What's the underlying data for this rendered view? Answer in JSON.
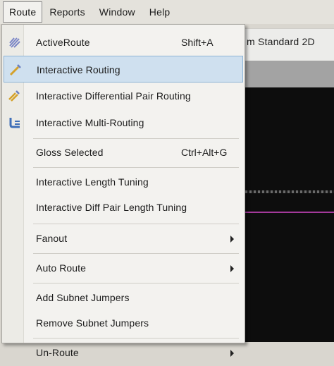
{
  "menubar": {
    "route": "Route",
    "reports": "Reports",
    "window": "Window",
    "help": "Help"
  },
  "document": {
    "view_label": "m Standard 2D"
  },
  "route_menu": {
    "items": [
      {
        "label": "ActiveRoute",
        "shortcut": "Shift+A",
        "icon": "active-route-icon"
      },
      {
        "label": "Interactive Routing",
        "icon": "interactive-routing-icon"
      },
      {
        "label": "Interactive Differential Pair Routing",
        "icon": "differential-pair-routing-icon"
      },
      {
        "label": "Interactive Multi-Routing",
        "icon": "multi-routing-icon"
      },
      {
        "label": "Gloss Selected",
        "shortcut": "Ctrl+Alt+G"
      },
      {
        "label": "Interactive Length Tuning"
      },
      {
        "label": "Interactive Diff Pair Length Tuning"
      },
      {
        "label": "Fanout"
      },
      {
        "label": "Auto Route"
      },
      {
        "label": "Add Subnet Jumpers"
      },
      {
        "label": "Remove Subnet Jumpers"
      },
      {
        "label": "Un-Route"
      }
    ]
  },
  "colors": {
    "highlight": "#cfe0ef",
    "menu_background": "#f3f2ef",
    "canvas": "#0d0d0d",
    "net_line": "#a3399a"
  }
}
